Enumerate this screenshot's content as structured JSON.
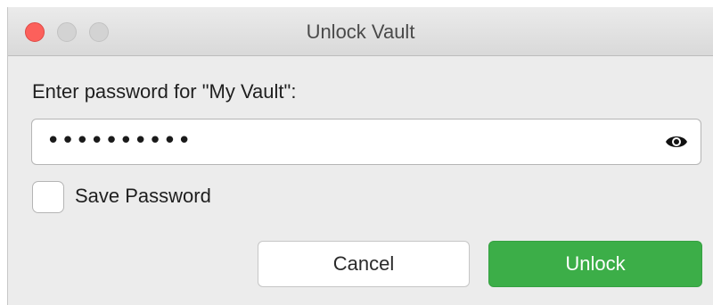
{
  "window": {
    "title": "Unlock Vault"
  },
  "form": {
    "prompt": "Enter password for \"My Vault\":",
    "password_masked": "••••••••••",
    "save_password_label": "Save Password",
    "save_password_checked": false
  },
  "buttons": {
    "cancel_label": "Cancel",
    "unlock_label": "Unlock"
  },
  "icons": {
    "show_password": "eye-icon"
  },
  "colors": {
    "close_button": "#fc605b",
    "unlock_button": "#3cae48",
    "window_background": "#ececec"
  }
}
